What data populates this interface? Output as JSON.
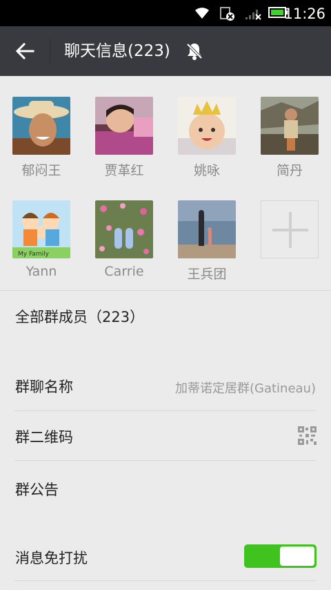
{
  "status_bar": {
    "time": "11:26"
  },
  "header": {
    "title": "聊天信息(223)",
    "icons": {
      "back": "arrow-left-icon",
      "mute": "bell-off-icon"
    }
  },
  "members": [
    {
      "name": "郁闷王",
      "avatar": "photo-man-cowboy-hat"
    },
    {
      "name": "贾革红",
      "avatar": "photo-child-lying"
    },
    {
      "name": "姚咏",
      "avatar": "photo-baby-crown"
    },
    {
      "name": "简丹",
      "avatar": "photo-girl-firewood"
    },
    {
      "name": "Yann",
      "avatar": "cartoon-family"
    },
    {
      "name": "Carrie",
      "avatar": "photo-shoes-flowers"
    },
    {
      "name": "王兵团",
      "avatar": "photo-beach-figures"
    }
  ],
  "add_member_icon": "plus-icon",
  "all_members_label": "全部群成员（223）",
  "group_name": {
    "label": "群聊名称",
    "value": "加蒂诺定居群(Gatineau)"
  },
  "group_qr": {
    "label": "群二维码",
    "icon": "qr-code-icon"
  },
  "announcement": {
    "label": "群公告"
  },
  "mute_notifications": {
    "label": "消息免打扰",
    "enabled": true
  },
  "colors": {
    "header_bg": "#393a3f",
    "toggle_on": "#40c21f",
    "page_bg": "#ebebeb"
  }
}
